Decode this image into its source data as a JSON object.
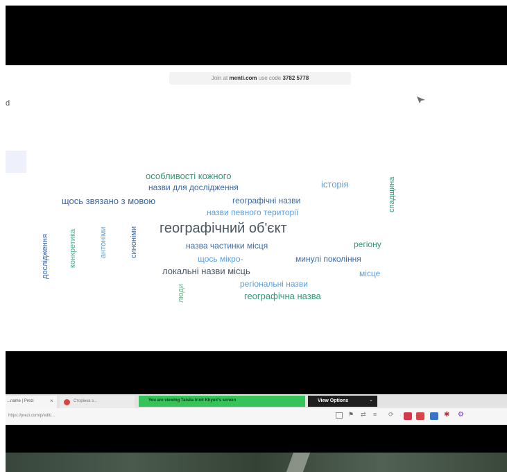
{
  "slide": {
    "join": {
      "prefix": "Join at",
      "site": "menti.com",
      "use_code": "use code",
      "code": "3782 5778"
    },
    "left_edge_letter": "d",
    "words": {
      "w1": "особливості кожного",
      "w2": "назви для дослідження",
      "w3": "історія",
      "w4": "щось звязано з мовою",
      "w5": "географічні назви",
      "w6": "назви певного території",
      "w7": "географічний об'єкт",
      "w8": "назва частинки місця",
      "w9": "регіону",
      "w10": "щось мікро-",
      "w11": "минулі покоління",
      "w12": "локальні назви місць",
      "w13": "місце",
      "w14": "регіональні назви",
      "w15": "географічна назва",
      "v1": "дослідження",
      "v2": "конкретика",
      "v3": "антоніми",
      "v4": "синоніми",
      "v5": "спадщина",
      "v6": "люди"
    }
  },
  "browser": {
    "tab1": "...name | Prezi",
    "tab2": "Сторінка з...",
    "sharing_notice": "You are viewing Taisiia Irinit Khyuir's screen",
    "view_options": "View Options",
    "address": "https://prezi.com/p/edit/...",
    "colors": {
      "notice_bg": "#35c35a",
      "menu_bg": "#1e1e1e"
    }
  }
}
